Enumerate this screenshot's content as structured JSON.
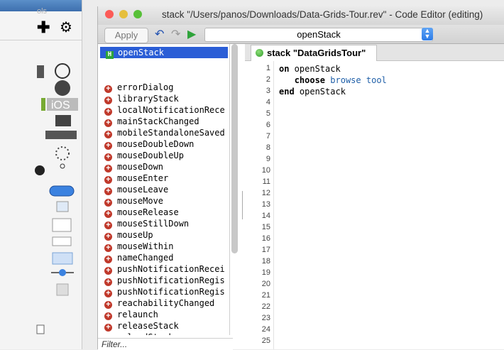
{
  "palette": {
    "title_fragment": "ols",
    "icons": [
      "plus-icon",
      "gear-icon",
      "pointer-icon",
      "globe-icon",
      "palette-icon",
      "ios-icon",
      "android-icon",
      "screen-icon",
      "stars-icon",
      "spinner-icon",
      "tree-icon",
      "button-icon",
      "field-icon",
      "slider-icon",
      "scrollbar-icon",
      "checkbox-icon",
      "image-icon"
    ],
    "ios_label": "iOS"
  },
  "window": {
    "title": "stack \"/Users/panos/Downloads/Data-Grids-Tour.rev\" - Code Editor (editing)",
    "traffic_lights": [
      "#fc5b57",
      "#e5bf3c",
      "#57c038"
    ]
  },
  "toolbar": {
    "apply_label": "Apply",
    "handler_select": "openStack"
  },
  "handler_list": {
    "selected": "openStack",
    "selected_badge": "H",
    "items": [
      "errorDialog",
      "libraryStack",
      "localNotificationRece",
      "mainStackChanged",
      "mobileStandaloneSaved",
      "mouseDoubleDown",
      "mouseDoubleUp",
      "mouseDown",
      "mouseEnter",
      "mouseLeave",
      "mouseMove",
      "mouseRelease",
      "mouseStillDown",
      "mouseUp",
      "mouseWithin",
      "nameChanged",
      "pushNotificationRecei",
      "pushNotificationRegis",
      "pushNotificationRegis",
      "reachabilityChanged",
      "relaunch",
      "releaseStack",
      "reloadStack"
    ],
    "filter_placeholder": "Filter..."
  },
  "editor": {
    "tab_label": "stack \"DataGridsTour\"",
    "line_numbers": [
      "1",
      "2",
      "3",
      "4",
      "5",
      "6",
      "7",
      "8",
      "9",
      "10",
      "11",
      "12",
      "13",
      "14",
      "15",
      "16",
      "17",
      "18",
      "19",
      "20",
      "21",
      "22",
      "23",
      "24",
      "25"
    ],
    "code": {
      "l1_kw": "on",
      "l1_rest": " openStack",
      "l2_kw": "choose",
      "l2_tk": "browse",
      "l2_rest": " tool",
      "l3_kw": "end",
      "l3_rest": " openStack"
    }
  },
  "colors": {
    "selection": "#2b5ed6",
    "accent": "#2d7ce8",
    "plus": "#c0392b"
  }
}
